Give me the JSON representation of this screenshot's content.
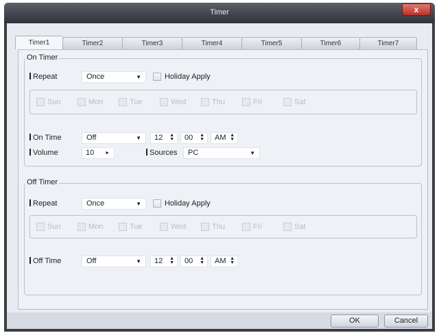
{
  "window": {
    "title": "Timer",
    "close_glyph": "x"
  },
  "tabs": [
    {
      "label": "Timer1",
      "active": true
    },
    {
      "label": "Timer2"
    },
    {
      "label": "Timer3"
    },
    {
      "label": "Timer4"
    },
    {
      "label": "Timer5"
    },
    {
      "label": "Timer6"
    },
    {
      "label": "Timer7"
    }
  ],
  "on_timer": {
    "group_title": "On Timer",
    "repeat_label": "Repeat",
    "repeat_value": "Once",
    "holiday_label": "Holiday Apply",
    "days": [
      "Sun",
      "Mon",
      "Tue",
      "Wed",
      "Thu",
      "Fri",
      "Sat"
    ],
    "time_label": "On Time",
    "time_mode": "Off",
    "hour": "12",
    "minute": "00",
    "ampm": "AM",
    "volume_label": "Volume",
    "volume_value": "10",
    "sources_label": "Sources",
    "sources_value": "PC"
  },
  "off_timer": {
    "group_title": "Off Timer",
    "repeat_label": "Repeat",
    "repeat_value": "Once",
    "holiday_label": "Holiday Apply",
    "days": [
      "Sun",
      "Mon",
      "Tue",
      "Wed",
      "Thu",
      "Fri",
      "Sat"
    ],
    "time_label": "Off Time",
    "time_mode": "Off",
    "hour": "12",
    "minute": "00",
    "ampm": "AM"
  },
  "buttons": {
    "ok": "OK",
    "cancel": "Cancel"
  },
  "icons": {
    "dropdown": "▼",
    "spin_up": "▲",
    "spin_down": "▼",
    "right_arrow": "►"
  }
}
